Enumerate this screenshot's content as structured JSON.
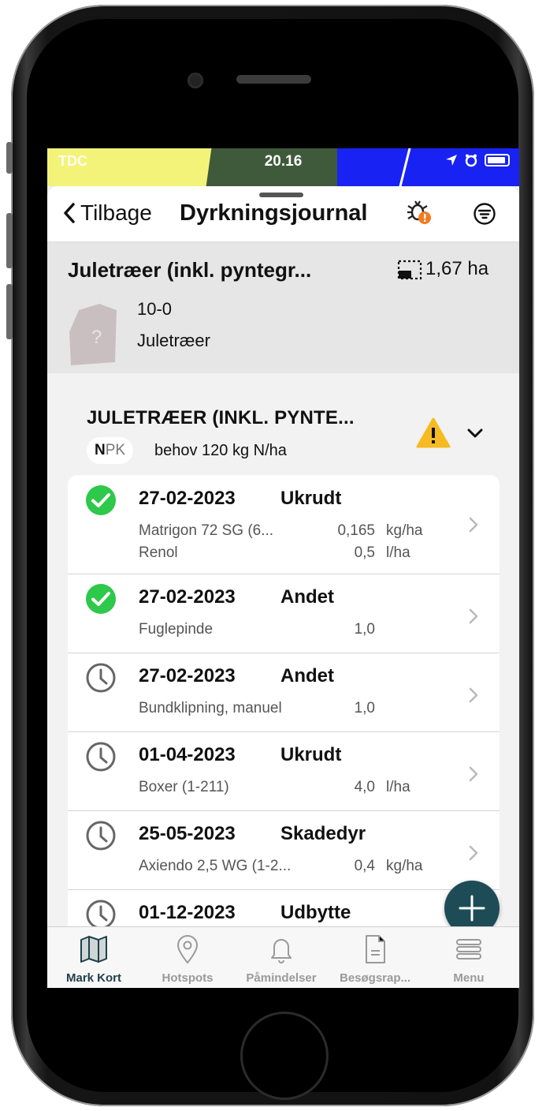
{
  "status_bar": {
    "carrier": "TDC",
    "time": "20.16"
  },
  "header": {
    "back_label": "Tilbage",
    "title": "Dyrkningsjournal"
  },
  "field": {
    "name": "Juletræer (inkl. pyntegr...",
    "area": "1,67 ha",
    "number": "10-0",
    "crop": "Juletræer",
    "shape_icon": "?"
  },
  "crop_section": {
    "heading": "JULETRÆER (INKL. PYNTE...",
    "npk_n": "N",
    "npk_pk": "PK",
    "need_text": "behov 120 kg N/ha"
  },
  "entries": [
    {
      "status": "done",
      "date": "27-02-2023",
      "type": "Ukrudt",
      "lines": [
        {
          "product": "Matrigon 72 SG (6...",
          "qty": "0,165",
          "unit": "kg/ha"
        },
        {
          "product": "Renol",
          "qty": "0,5",
          "unit": "l/ha"
        }
      ]
    },
    {
      "status": "done",
      "date": "27-02-2023",
      "type": "Andet",
      "lines": [
        {
          "product": "Fuglepinde",
          "qty": "1,0",
          "unit": ""
        }
      ]
    },
    {
      "status": "planned",
      "date": "27-02-2023",
      "type": "Andet",
      "lines": [
        {
          "product": "Bundklipning, manuel",
          "qty": "1,0",
          "unit": ""
        }
      ]
    },
    {
      "status": "planned",
      "date": "01-04-2023",
      "type": "Ukrudt",
      "lines": [
        {
          "product": "Boxer (1-211)",
          "qty": "4,0",
          "unit": "l/ha"
        }
      ]
    },
    {
      "status": "planned",
      "date": "25-05-2023",
      "type": "Skadedyr",
      "lines": [
        {
          "product": "Axiendo 2,5 WG (1-2...",
          "qty": "0,4",
          "unit": "kg/ha"
        }
      ]
    },
    {
      "status": "planned",
      "date": "01-12-2023",
      "type": "Udbytte",
      "lines": []
    }
  ],
  "tabs": [
    {
      "label": "Mark Kort",
      "icon": "map-icon",
      "active": true
    },
    {
      "label": "Hotspots",
      "icon": "pin-icon",
      "active": false
    },
    {
      "label": "Påmindelser",
      "icon": "bell-icon",
      "active": false
    },
    {
      "label": "Besøgsrap...",
      "icon": "document-icon",
      "active": false
    },
    {
      "label": "Menu",
      "icon": "menu-icon",
      "active": false
    }
  ],
  "colors": {
    "accent": "#1d4c56",
    "done_green": "#2ec84a",
    "warning": "#f6bb23",
    "status_blue": "#1722f3"
  }
}
